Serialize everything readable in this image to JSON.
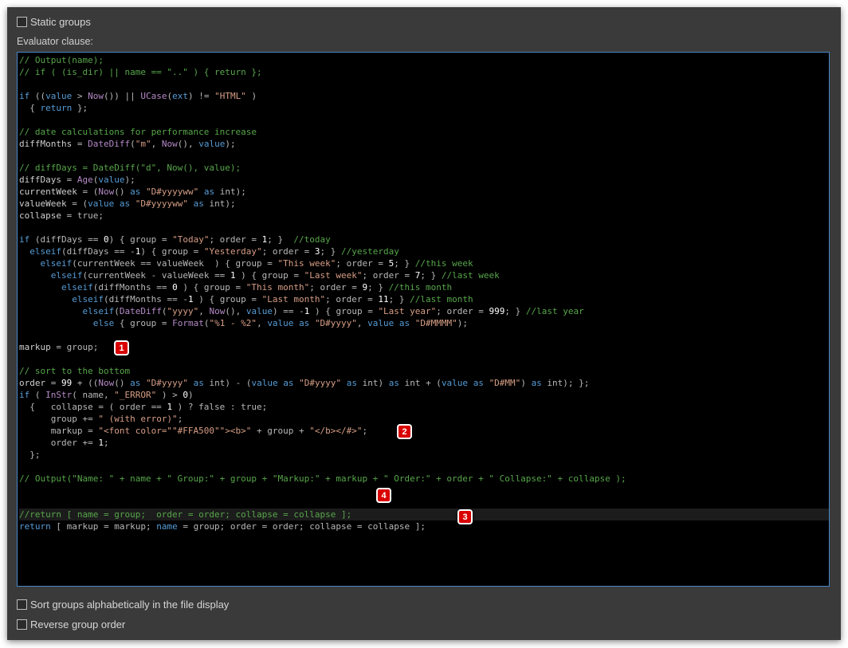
{
  "checkboxes": {
    "static_groups": {
      "label": "Static groups",
      "checked": false
    },
    "sort_alpha": {
      "label": "Sort groups alphabetically in the file display",
      "checked": false
    },
    "reverse_order": {
      "label": "Reverse group order",
      "checked": false
    }
  },
  "evaluator_label": "Evaluator clause:",
  "highlight_line": 38,
  "code_lines": [
    [
      [
        "c",
        "// Output(name);"
      ]
    ],
    [
      [
        "c",
        "// if ( (is_dir) || name == \"..\" ) { return };"
      ]
    ],
    [],
    [
      [
        "k",
        "if"
      ],
      [
        "o",
        " (("
      ],
      [
        "k",
        "value"
      ],
      [
        "o",
        " > "
      ],
      [
        "f",
        "Now"
      ],
      [
        "o",
        "()) || "
      ],
      [
        "f",
        "UCase"
      ],
      [
        "o",
        "("
      ],
      [
        "k",
        "ext"
      ],
      [
        "o",
        ") != "
      ],
      [
        "s",
        "\"HTML\""
      ],
      [
        "o",
        " )"
      ]
    ],
    [
      [
        "o",
        "  { "
      ],
      [
        "k",
        "return"
      ],
      [
        "o",
        " };"
      ]
    ],
    [],
    [
      [
        "c",
        "// date calculations for performance increase"
      ]
    ],
    [
      [
        "v",
        "diffMonths"
      ],
      [
        "o",
        " = "
      ],
      [
        "f",
        "DateDiff"
      ],
      [
        "o",
        "("
      ],
      [
        "s",
        "\"m\""
      ],
      [
        "o",
        ", "
      ],
      [
        "f",
        "Now"
      ],
      [
        "o",
        "(), "
      ],
      [
        "k",
        "value"
      ],
      [
        "o",
        ");"
      ]
    ],
    [],
    [
      [
        "c",
        "// diffDays = DateDiff(\"d\", Now(), value);"
      ]
    ],
    [
      [
        "v",
        "diffDays"
      ],
      [
        "o",
        " = "
      ],
      [
        "f",
        "Age"
      ],
      [
        "o",
        "("
      ],
      [
        "k",
        "value"
      ],
      [
        "o",
        ");"
      ]
    ],
    [
      [
        "v",
        "currentWeek"
      ],
      [
        "o",
        " = ("
      ],
      [
        "f",
        "Now"
      ],
      [
        "o",
        "() "
      ],
      [
        "k",
        "as"
      ],
      [
        "o",
        " "
      ],
      [
        "s",
        "\"D#yyyyww\""
      ],
      [
        "o",
        " "
      ],
      [
        "k",
        "as"
      ],
      [
        "o",
        " int);"
      ]
    ],
    [
      [
        "v",
        "valueWeek"
      ],
      [
        "o",
        " = ("
      ],
      [
        "k",
        "value"
      ],
      [
        "o",
        " "
      ],
      [
        "k",
        "as"
      ],
      [
        "o",
        " "
      ],
      [
        "s",
        "\"D#yyyyww\""
      ],
      [
        "o",
        " "
      ],
      [
        "k",
        "as"
      ],
      [
        "o",
        " int);"
      ]
    ],
    [
      [
        "v",
        "collapse"
      ],
      [
        "o",
        " = true;"
      ]
    ],
    [],
    [
      [
        "k",
        "if"
      ],
      [
        "o",
        " (diffDays == "
      ],
      [
        "n",
        "0"
      ],
      [
        "o",
        ") { group = "
      ],
      [
        "s",
        "\"Today\""
      ],
      [
        "o",
        "; order = "
      ],
      [
        "n",
        "1"
      ],
      [
        "o",
        "; }  "
      ],
      [
        "c",
        "//today"
      ]
    ],
    [
      [
        "o",
        "  "
      ],
      [
        "k",
        "elseif"
      ],
      [
        "o",
        "(diffDays == -"
      ],
      [
        "n",
        "1"
      ],
      [
        "o",
        ") { group = "
      ],
      [
        "s",
        "\"Yesterday\""
      ],
      [
        "o",
        "; order = "
      ],
      [
        "n",
        "3"
      ],
      [
        "o",
        "; } "
      ],
      [
        "c",
        "//yesterday"
      ]
    ],
    [
      [
        "o",
        "    "
      ],
      [
        "k",
        "elseif"
      ],
      [
        "o",
        "(currentWeek == valueWeek  ) { group = "
      ],
      [
        "s",
        "\"This week\""
      ],
      [
        "o",
        "; order = "
      ],
      [
        "n",
        "5"
      ],
      [
        "o",
        "; } "
      ],
      [
        "c",
        "//this week"
      ]
    ],
    [
      [
        "o",
        "      "
      ],
      [
        "k",
        "elseif"
      ],
      [
        "o",
        "(currentWeek - valueWeek == "
      ],
      [
        "n",
        "1"
      ],
      [
        "o",
        " ) { group = "
      ],
      [
        "s",
        "\"Last week\""
      ],
      [
        "o",
        "; order = "
      ],
      [
        "n",
        "7"
      ],
      [
        "o",
        "; } "
      ],
      [
        "c",
        "//last week"
      ]
    ],
    [
      [
        "o",
        "        "
      ],
      [
        "k",
        "elseif"
      ],
      [
        "o",
        "(diffMonths == "
      ],
      [
        "n",
        "0"
      ],
      [
        "o",
        " ) { group = "
      ],
      [
        "s",
        "\"This month\""
      ],
      [
        "o",
        "; order = "
      ],
      [
        "n",
        "9"
      ],
      [
        "o",
        "; } "
      ],
      [
        "c",
        "//this month"
      ]
    ],
    [
      [
        "o",
        "          "
      ],
      [
        "k",
        "elseif"
      ],
      [
        "o",
        "(diffMonths == -"
      ],
      [
        "n",
        "1"
      ],
      [
        "o",
        " ) { group = "
      ],
      [
        "s",
        "\"Last month\""
      ],
      [
        "o",
        "; order = "
      ],
      [
        "n",
        "11"
      ],
      [
        "o",
        "; } "
      ],
      [
        "c",
        "//last month"
      ]
    ],
    [
      [
        "o",
        "            "
      ],
      [
        "k",
        "elseif"
      ],
      [
        "o",
        "("
      ],
      [
        "f",
        "DateDiff"
      ],
      [
        "o",
        "("
      ],
      [
        "s",
        "\"yyyy\""
      ],
      [
        "o",
        ", "
      ],
      [
        "f",
        "Now"
      ],
      [
        "o",
        "(), "
      ],
      [
        "k",
        "value"
      ],
      [
        "o",
        ") == -"
      ],
      [
        "n",
        "1"
      ],
      [
        "o",
        " ) { group = "
      ],
      [
        "s",
        "\"Last year\""
      ],
      [
        "o",
        "; order = "
      ],
      [
        "n",
        "999"
      ],
      [
        "o",
        "; } "
      ],
      [
        "c",
        "//last year"
      ]
    ],
    [
      [
        "o",
        "              "
      ],
      [
        "k",
        "else"
      ],
      [
        "o",
        " { group = "
      ],
      [
        "f",
        "Format"
      ],
      [
        "o",
        "("
      ],
      [
        "s",
        "\"%1 - %2\""
      ],
      [
        "o",
        ", "
      ],
      [
        "k",
        "value"
      ],
      [
        "o",
        " "
      ],
      [
        "k",
        "as"
      ],
      [
        "o",
        " "
      ],
      [
        "s",
        "\"D#yyyy\""
      ],
      [
        "o",
        ", "
      ],
      [
        "k",
        "value"
      ],
      [
        "o",
        " "
      ],
      [
        "k",
        "as"
      ],
      [
        "o",
        " "
      ],
      [
        "s",
        "\"D#MMMM\""
      ],
      [
        "o",
        ");"
      ]
    ],
    [],
    [
      [
        "v",
        "markup"
      ],
      [
        "o",
        " = group;"
      ]
    ],
    [],
    [
      [
        "c",
        "// sort to the bottom"
      ]
    ],
    [
      [
        "v",
        "order"
      ],
      [
        "o",
        " = "
      ],
      [
        "n",
        "99"
      ],
      [
        "o",
        " + (("
      ],
      [
        "f",
        "Now"
      ],
      [
        "o",
        "() "
      ],
      [
        "k",
        "as"
      ],
      [
        "o",
        " "
      ],
      [
        "s",
        "\"D#yyyy\""
      ],
      [
        "o",
        " "
      ],
      [
        "k",
        "as"
      ],
      [
        "o",
        " int) - ("
      ],
      [
        "k",
        "value"
      ],
      [
        "o",
        " "
      ],
      [
        "k",
        "as"
      ],
      [
        "o",
        " "
      ],
      [
        "s",
        "\"D#yyyy\""
      ],
      [
        "o",
        " "
      ],
      [
        "k",
        "as"
      ],
      [
        "o",
        " int) "
      ],
      [
        "k",
        "as"
      ],
      [
        "o",
        " int + ("
      ],
      [
        "k",
        "value"
      ],
      [
        "o",
        " "
      ],
      [
        "k",
        "as"
      ],
      [
        "o",
        " "
      ],
      [
        "s",
        "\"D#MM\""
      ],
      [
        "o",
        ") "
      ],
      [
        "k",
        "as"
      ],
      [
        "o",
        " int); };"
      ]
    ],
    [
      [
        "k",
        "if"
      ],
      [
        "o",
        " ( "
      ],
      [
        "f",
        "InStr"
      ],
      [
        "o",
        "( name, "
      ],
      [
        "s",
        "\"_ERROR\""
      ],
      [
        "o",
        " ) > "
      ],
      [
        "n",
        "0"
      ],
      [
        "o",
        ")"
      ]
    ],
    [
      [
        "o",
        "  {   collapse = ( order == "
      ],
      [
        "n",
        "1"
      ],
      [
        "o",
        " ) ? false : true;"
      ]
    ],
    [
      [
        "o",
        "      group += "
      ],
      [
        "s",
        "\" (with error)\""
      ],
      [
        "o",
        ";"
      ]
    ],
    [
      [
        "o",
        "      markup = "
      ],
      [
        "s",
        "\"<font color=\"\"#FFA500\"\"><b>\""
      ],
      [
        "o",
        " + group + "
      ],
      [
        "s",
        "\"</b></#>\""
      ],
      [
        "o",
        ";"
      ]
    ],
    [
      [
        "o",
        "      order += "
      ],
      [
        "n",
        "1"
      ],
      [
        "o",
        ";"
      ]
    ],
    [
      [
        "o",
        "  };"
      ]
    ],
    [],
    [
      [
        "c",
        "// Output(\"Name: \" + name + \" Group:\" + group + \"Markup:\" + markup + \" Order:\" + order + \" Collapse:\" + collapse );"
      ]
    ],
    [],
    [],
    [
      [
        "c",
        "//return [ name = group;  order = order; collapse = collapse ];"
      ]
    ],
    [
      [
        "k",
        "return"
      ],
      [
        "o",
        " [ markup = markup; "
      ],
      [
        "k",
        "name"
      ],
      [
        "o",
        " = group; order = order; collapse = collapse ];"
      ]
    ]
  ],
  "badges": [
    {
      "label": "1",
      "name": "callout-badge-1"
    },
    {
      "label": "2",
      "name": "callout-badge-2"
    },
    {
      "label": "3",
      "name": "callout-badge-3"
    },
    {
      "label": "4",
      "name": "callout-badge-4"
    }
  ]
}
